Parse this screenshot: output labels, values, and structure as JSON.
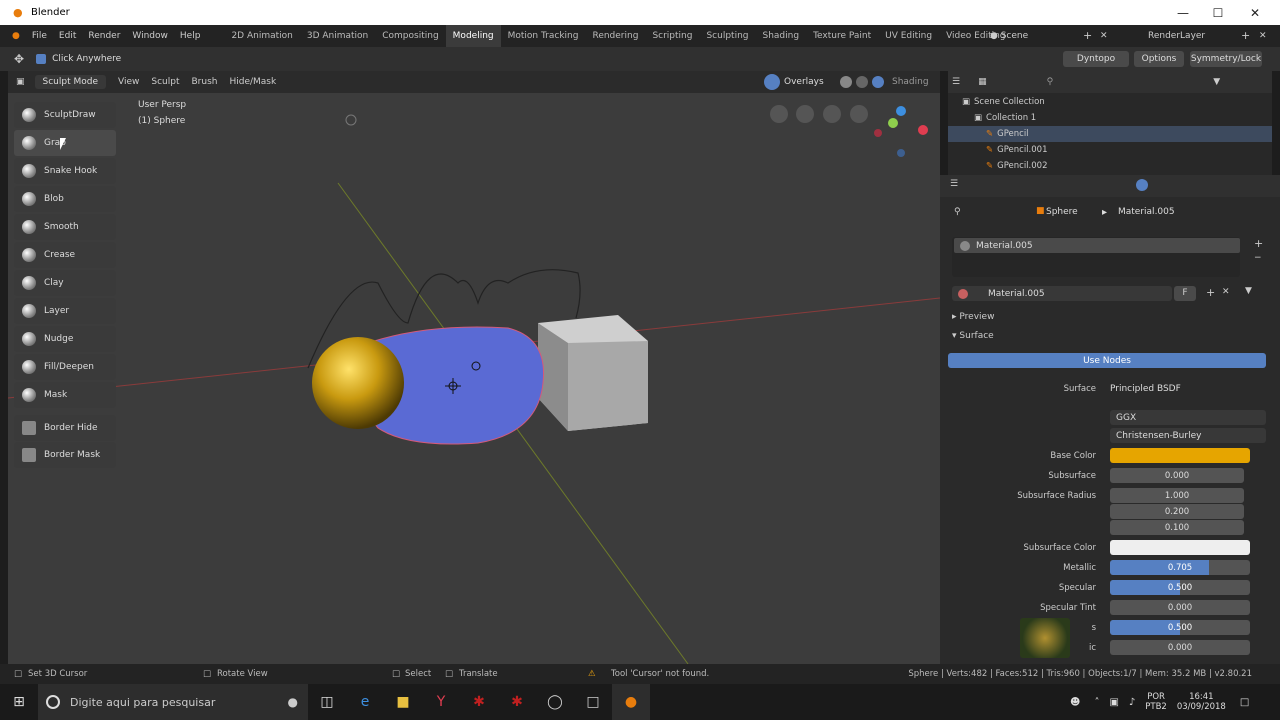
{
  "window": {
    "title": "Blender"
  },
  "menu": [
    "File",
    "Edit",
    "Render",
    "Window",
    "Help"
  ],
  "workspaces": [
    "2D Animation",
    "3D Animation",
    "Compositing",
    "Modeling",
    "Motion Tracking",
    "Rendering",
    "Scripting",
    "Sculpting",
    "Shading",
    "Texture Paint",
    "UV Editing",
    "Video Editing"
  ],
  "active_workspace": "Modeling",
  "scene": {
    "name": "Scene",
    "render_layer": "RenderLayer"
  },
  "toolheader": {
    "click_anywhere": "Click Anywhere",
    "dyntopo": "Dyntopo",
    "options": "Options",
    "symmetry": "Symmetry/Lock"
  },
  "viewport_header": {
    "mode": "Sculpt Mode",
    "view": "View",
    "sculpt": "Sculpt",
    "brush": "Brush",
    "hide_mask": "Hide/Mask",
    "overlays": "Overlays",
    "shading": "Shading"
  },
  "viewport": {
    "persp": "User Persp",
    "object": "(1) Sphere"
  },
  "tools": [
    "SculptDraw",
    "Grab",
    "Snake Hook",
    "Blob",
    "Smooth",
    "Crease",
    "Clay",
    "Layer",
    "Nudge",
    "Fill/Deepen",
    "Mask",
    "Border Hide",
    "Border Mask"
  ],
  "outliner": {
    "root": "Scene Collection",
    "collection": "Collection 1",
    "items": [
      "GPencil",
      "GPencil.001",
      "GPencil.002"
    ]
  },
  "props": {
    "object": "Sphere",
    "material": "Material.005",
    "slot": "Material.005",
    "material_field": "Material.005",
    "fake_user": "F",
    "preview": "Preview",
    "surface_section": "Surface",
    "use_nodes": "Use Nodes",
    "surface_label": "Surface",
    "surface_value": "Principled BSDF",
    "distribution": "GGX",
    "subsurface_method": "Christensen-Burley",
    "base_color_label": "Base Color",
    "base_color": "#e6a500",
    "subsurface_label": "Subsurface",
    "subsurface": "0.000",
    "radius_label": "Subsurface Radius",
    "radius": [
      "1.000",
      "0.200",
      "0.100"
    ],
    "ss_color_label": "Subsurface Color",
    "metallic_label": "Metallic",
    "metallic": "0.705",
    "metallic_frac": 0.705,
    "specular_label": "Specular",
    "specular": "0.500",
    "specular_frac": 0.5,
    "spec_tint_label": "Specular Tint",
    "spec_tint": "0.000",
    "row_rough_label": "s",
    "roughness": "0.500",
    "roughness_frac": 0.5,
    "row_aniso_label": "ic",
    "anisotropic": "0.000"
  },
  "status": {
    "left": "Set 3D Cursor",
    "rotate": "Rotate View",
    "select": "Select",
    "translate": "Translate",
    "warning": "Tool 'Cursor' not found.",
    "stats": "Sphere | Verts:482 | Faces:512 | Tris:960 | Objects:1/7 | Mem: 35.2 MB | v2.80.21"
  },
  "taskbar": {
    "search_placeholder": "Digite aqui para pesquisar",
    "lang1": "POR",
    "lang2": "PTB2",
    "time": "16:41",
    "date": "03/09/2018"
  }
}
